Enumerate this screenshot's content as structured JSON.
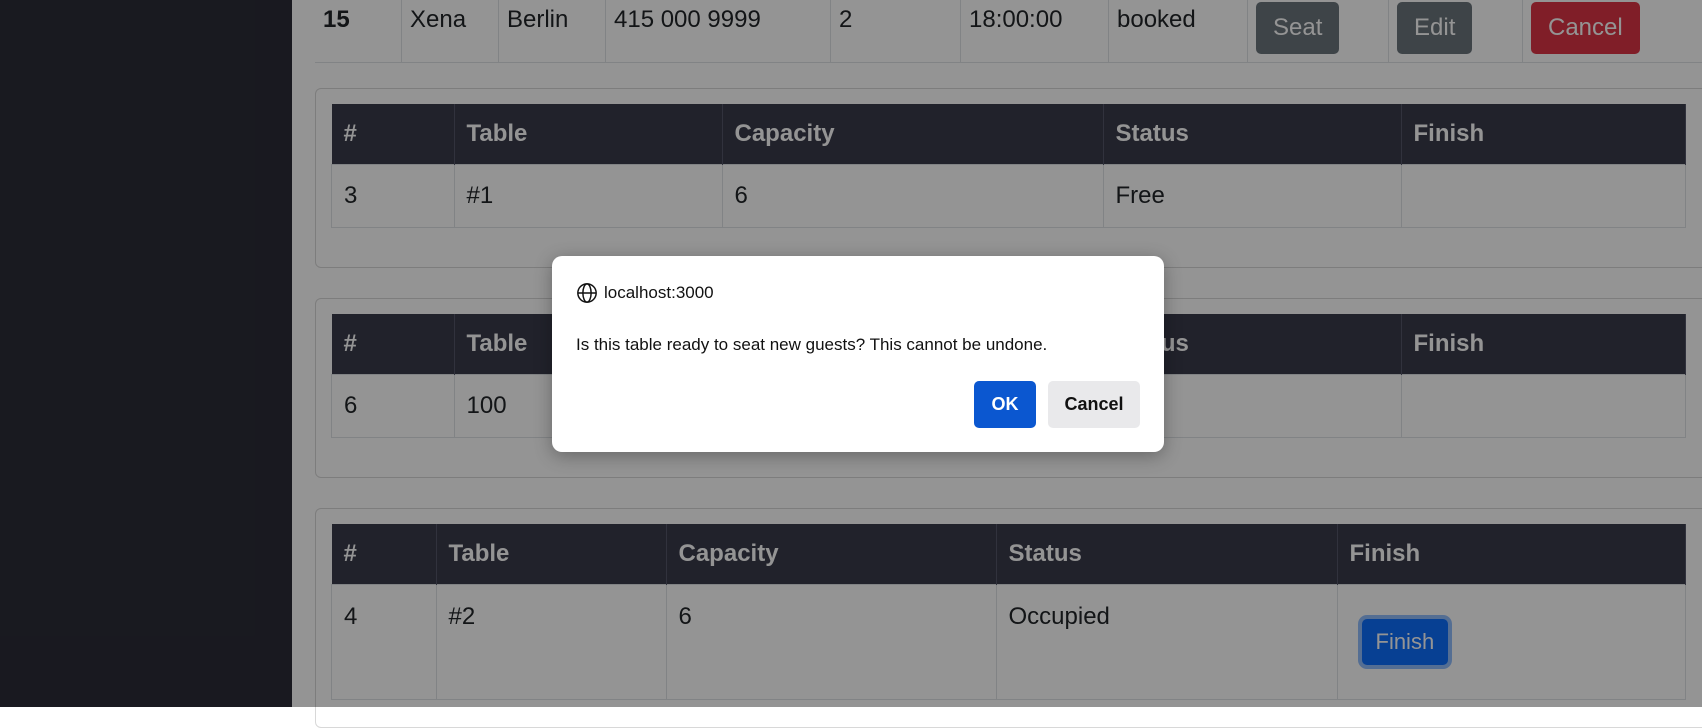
{
  "reservation": {
    "id": "15",
    "first_name": "Xena",
    "last_name": "Berlin",
    "mobile": "415 000 9999",
    "people": "2",
    "time": "18:00:00",
    "status": "booked",
    "seat_label": "Seat",
    "edit_label": "Edit",
    "cancel_label": "Cancel"
  },
  "table_headers": [
    "#",
    "Table",
    "Capacity",
    "Status",
    "Finish"
  ],
  "tables": [
    {
      "id": "3",
      "name": "#1",
      "capacity": "6",
      "status": "Free",
      "finish_label": ""
    },
    {
      "id": "6",
      "name": "100",
      "capacity": "",
      "status": "",
      "finish_label": ""
    },
    {
      "id": "4",
      "name": "#2",
      "capacity": "6",
      "status": "Occupied",
      "finish_label": "Finish"
    }
  ],
  "dialog": {
    "origin": "localhost:3000",
    "message": "Is this table ready to seat new guests? This cannot be undone.",
    "ok_label": "OK",
    "cancel_label": "Cancel"
  },
  "colors": {
    "sidebar": "#2b2c37",
    "header": "#3a3b4a",
    "primary": "#0d6efd",
    "danger": "#dc3545",
    "secondary": "#6c757d",
    "dialog_ok": "#0b57d0"
  },
  "icons": {
    "origin": "globe-icon"
  }
}
